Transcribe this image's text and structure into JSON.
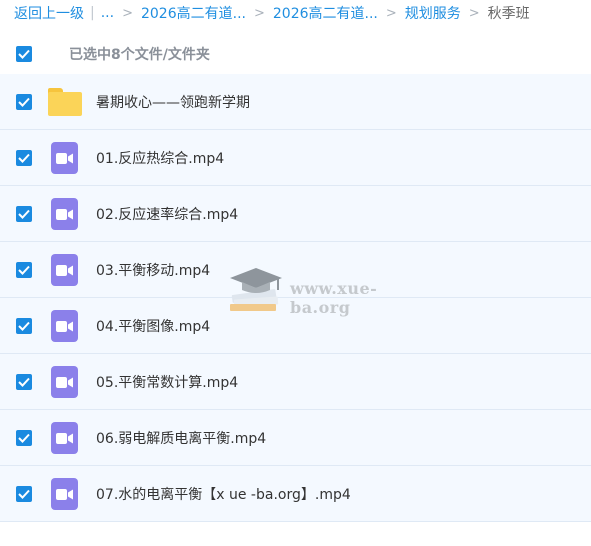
{
  "breadcrumb": {
    "back": "返回上一级",
    "divider": "|",
    "ellipsis": "...",
    "crumbs": [
      "2026高二有道...",
      "2026高二有道...",
      "规划服务"
    ],
    "current": "秋季班"
  },
  "selection": {
    "summary": "已选中8个文件/文件夹"
  },
  "files": [
    {
      "name": "暑期收心——领跑新学期",
      "type": "folder",
      "checked": true
    },
    {
      "name": "01.反应热综合.mp4",
      "type": "video",
      "checked": true
    },
    {
      "name": "02.反应速率综合.mp4",
      "type": "video",
      "checked": true
    },
    {
      "name": "03.平衡移动.mp4",
      "type": "video",
      "checked": true
    },
    {
      "name": "04.平衡图像.mp4",
      "type": "video",
      "checked": true
    },
    {
      "name": "05.平衡常数计算.mp4",
      "type": "video",
      "checked": true
    },
    {
      "name": "06.弱电解质电离平衡.mp4",
      "type": "video",
      "checked": true
    },
    {
      "name": "07.水的电离平衡【x ue -ba.org】.mp4",
      "type": "video",
      "checked": true
    }
  ],
  "watermark": {
    "text": "www.xue-ba.org"
  },
  "colors": {
    "link": "#1f8ee0",
    "checkbox": "#1a8ae0",
    "row_background": "#f4f9ff",
    "folder": "#fbd458",
    "video": "#8b80ea"
  }
}
